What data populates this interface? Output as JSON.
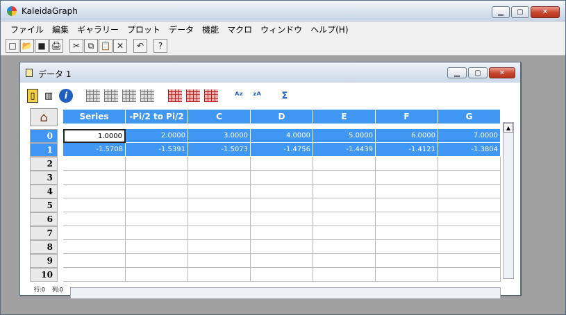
{
  "app": {
    "title": "KaleidaGraph"
  },
  "menu": [
    "ファイル",
    "編集",
    "ギャラリー",
    "プロット",
    "データ",
    "機能",
    "マクロ",
    "ウィンドウ",
    "ヘルプ(H)"
  ],
  "toolbar_icons": [
    "new-document-icon",
    "open-folder-icon",
    "save-icon",
    "print-icon",
    "cut-icon",
    "copy-icon",
    "paste-icon",
    "delete-icon",
    "undo-icon",
    "help-icon"
  ],
  "toolbar_glyphs": [
    "□",
    "📂",
    "■",
    "🖨",
    "✂",
    "⧉",
    "📋",
    "✕",
    "↶",
    "?"
  ],
  "data_window": {
    "title": "データ 1",
    "tools": [
      "notes-icon",
      "plot-icon",
      "info-icon",
      "insert-column-icon",
      "move-left-icon",
      "insert-row-icon",
      "move-up-icon",
      "grid-red-1-icon",
      "grid-red-2-icon",
      "grid-red-3-icon",
      "sort-az-icon",
      "sort-za-icon",
      "sum-icon"
    ],
    "columns": [
      "Series",
      "-Pi/2 to Pi/2",
      "C",
      "D",
      "E",
      "F",
      "G"
    ],
    "rows": [
      {
        "num": "0",
        "cells": [
          "1.0000",
          "2.0000",
          "3.0000",
          "4.0000",
          "5.0000",
          "6.0000",
          "7.0000"
        ]
      },
      {
        "num": "1",
        "cells": [
          "-1.5708",
          "-1.5391",
          "-1.5073",
          "-1.4756",
          "-1.4439",
          "-1.4121",
          "-1.3804"
        ]
      },
      {
        "num": "2",
        "cells": [
          "",
          "",
          "",
          "",
          "",
          "",
          ""
        ]
      },
      {
        "num": "3",
        "cells": [
          "",
          "",
          "",
          "",
          "",
          "",
          ""
        ]
      },
      {
        "num": "4",
        "cells": [
          "",
          "",
          "",
          "",
          "",
          "",
          ""
        ]
      },
      {
        "num": "5",
        "cells": [
          "",
          "",
          "",
          "",
          "",
          "",
          ""
        ]
      },
      {
        "num": "6",
        "cells": [
          "",
          "",
          "",
          "",
          "",
          "",
          ""
        ]
      },
      {
        "num": "7",
        "cells": [
          "",
          "",
          "",
          "",
          "",
          "",
          ""
        ]
      },
      {
        "num": "8",
        "cells": [
          "",
          "",
          "",
          "",
          "",
          "",
          ""
        ]
      },
      {
        "num": "9",
        "cells": [
          "",
          "",
          "",
          "",
          "",
          "",
          ""
        ]
      },
      {
        "num": "10",
        "cells": [
          "",
          "",
          "",
          "",
          "",
          "",
          ""
        ]
      }
    ],
    "status": {
      "row_label": "行:0",
      "col_label": "列:0"
    }
  }
}
